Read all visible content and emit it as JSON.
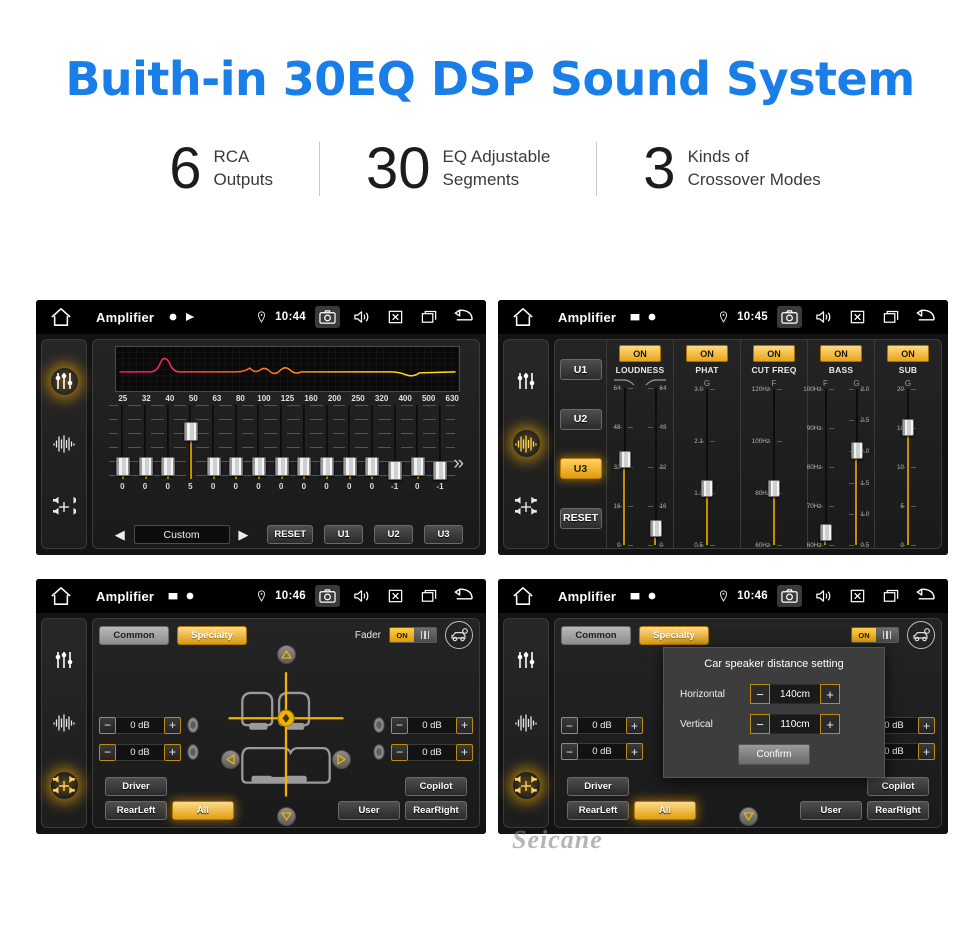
{
  "hero": {
    "title": "Buith-in 30EQ DSP Sound System",
    "color": "#1a7ee8"
  },
  "stats": [
    {
      "number": "6",
      "text": "RCA\nOutputs"
    },
    {
      "number": "30",
      "text": "EQ Adjustable\nSegments"
    },
    {
      "number": "3",
      "text": "Kinds of\nCrossover Modes"
    }
  ],
  "panels": {
    "eq": {
      "statusbar": {
        "title": "Amplifier",
        "time": "10:44"
      },
      "frequencies": [
        "25",
        "32",
        "40",
        "50",
        "63",
        "80",
        "100",
        "125",
        "160",
        "200",
        "250",
        "320",
        "400",
        "500",
        "630"
      ],
      "values": [
        "0",
        "0",
        "0",
        "5",
        "0",
        "0",
        "0",
        "0",
        "0",
        "0",
        "0",
        "0",
        "-1",
        "0",
        "-1"
      ],
      "preset": "Custom",
      "reset_label": "RESET",
      "user_presets": [
        "U1",
        "U2",
        "U3"
      ],
      "next_label": "»",
      "prev_arrow": "◀",
      "next_arrow": "▶"
    },
    "crossover": {
      "statusbar": {
        "title": "Amplifier",
        "time": "10:45"
      },
      "user_buttons": [
        "U1",
        "U2",
        "U3"
      ],
      "active_user": "U3",
      "reset_label": "RESET",
      "columns": [
        {
          "name": "LOUDNESS",
          "state": "ON",
          "subs": [
            "",
            ""
          ],
          "sliders": [
            {
              "labels_left": [
                "64",
                "48",
                "32",
                "16",
                "0"
              ],
              "pos": 0.46
            },
            {
              "labels_right": [
                "64",
                "48",
                "32",
                "16",
                "0"
              ],
              "pos": 0.9
            }
          ]
        },
        {
          "name": "PHAT",
          "state": "ON",
          "subs": [
            "G"
          ],
          "sliders": [
            {
              "labels_left": [
                "3.0",
                "2.1",
                "1.3",
                "0.5"
              ],
              "pos": 0.64
            }
          ]
        },
        {
          "name": "CUT FREQ",
          "state": "ON",
          "subs": [
            "F"
          ],
          "sliders": [
            {
              "labels_left": [
                "120Hz",
                "100Hz",
                "80Hz",
                "60Hz"
              ],
              "pos": 0.64
            }
          ]
        },
        {
          "name": "BASS",
          "state": "ON",
          "subs": [
            "F",
            "G"
          ],
          "sliders": [
            {
              "labels_left": [
                "100Hz",
                "90Hz",
                "80Hz",
                "70Hz",
                "60Hz"
              ],
              "pos": 0.92
            },
            {
              "labels_right": [
                "3.0",
                "2.5",
                "2.0",
                "1.5",
                "1.0",
                "0.5"
              ],
              "pos": 0.4
            }
          ]
        },
        {
          "name": "SUB",
          "state": "ON",
          "subs": [
            "G"
          ],
          "sliders": [
            {
              "labels_left": [
                "20",
                "15",
                "10",
                "5",
                "0"
              ],
              "pos": 0.25
            }
          ]
        }
      ]
    },
    "fader": {
      "statusbar": {
        "title": "Amplifier",
        "time": "10:46"
      },
      "tabs": [
        {
          "label": "Common",
          "active": false
        },
        {
          "label": "Specialty",
          "active": true
        }
      ],
      "fader_label": "Fader",
      "toggle_state": "ON",
      "levels": [
        "0 dB",
        "0 dB",
        "0 dB",
        "0 dB"
      ],
      "minus": "−",
      "plus": "+",
      "buttons_left": [
        {
          "label": "Driver",
          "active": false
        },
        {
          "label": "RearLeft",
          "active": false
        }
      ],
      "buttons_center": [
        {
          "label": "All",
          "active": true
        }
      ],
      "buttons_right": [
        {
          "label": "Copilot",
          "active": false
        },
        {
          "label": "User",
          "active": false
        },
        {
          "label": "RearRight",
          "active": false
        }
      ]
    },
    "dialog": {
      "statusbar": {
        "title": "Amplifier",
        "time": "10:46"
      },
      "title": "Car speaker distance setting",
      "rows": [
        {
          "label": "Horizontal",
          "value": "140cm"
        },
        {
          "label": "Vertical",
          "value": "110cm"
        }
      ],
      "confirm_label": "Confirm"
    }
  },
  "watermark": "Seicane"
}
